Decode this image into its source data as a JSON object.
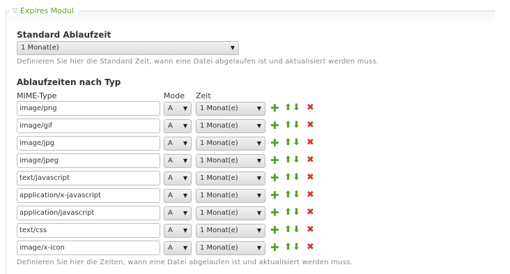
{
  "legend": "Expires Modul",
  "default_section": {
    "title": "Standard Ablaufzeit",
    "selected": "1 Monat(e)",
    "help": "Definieren Sie hier die Standard Zeit, wann eine Datei abgelaufen ist und aktualisiert werden muss."
  },
  "types_section": {
    "title": "Ablaufzeiten nach Typ",
    "col_mime": "MIME-Type",
    "col_mode": "Mode",
    "col_zeit": "Zeit",
    "rows": [
      {
        "mime": "image/png",
        "mode": "A",
        "zeit": "1 Monat(e)"
      },
      {
        "mime": "image/gif",
        "mode": "A",
        "zeit": "1 Monat(e)"
      },
      {
        "mime": "image/jpg",
        "mode": "A",
        "zeit": "1 Monat(e)"
      },
      {
        "mime": "image/jpeg",
        "mode": "A",
        "zeit": "1 Monat(e)"
      },
      {
        "mime": "text/javascript",
        "mode": "A",
        "zeit": "1 Monat(e)"
      },
      {
        "mime": "application/x-javascript",
        "mode": "A",
        "zeit": "1 Monat(e)"
      },
      {
        "mime": "application/javascript",
        "mode": "A",
        "zeit": "1 Monat(e)"
      },
      {
        "mime": "text/css",
        "mode": "A",
        "zeit": "1 Monat(e)"
      },
      {
        "mime": "image/x-icon",
        "mode": "A",
        "zeit": "1 Monat(e)"
      }
    ],
    "help": "Definieren Sie hier die Zeiten, wann eine Datei abgelaufen ist und aktualisiert werden muss."
  },
  "icons": {
    "legend_toggle": "triangle-down-icon",
    "add": "plus-icon",
    "move_up": "arrow-up-icon",
    "move_down": "arrow-down-icon",
    "delete": "close-icon"
  },
  "colors": {
    "legend": "#5f9b2f",
    "add": "#5aa02c",
    "delete": "#d23a2a"
  }
}
